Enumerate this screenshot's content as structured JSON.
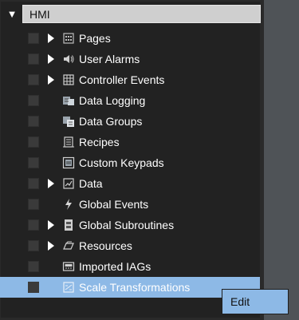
{
  "tree": {
    "root_label": "HMI",
    "items": [
      {
        "label": "Pages",
        "icon": "pages-icon",
        "expandable": true
      },
      {
        "label": "User Alarms",
        "icon": "speaker-icon",
        "expandable": true
      },
      {
        "label": "Controller Events",
        "icon": "grid-icon",
        "expandable": true
      },
      {
        "label": "Data Logging",
        "icon": "data-logging-icon",
        "expandable": false
      },
      {
        "label": "Data Groups",
        "icon": "data-groups-icon",
        "expandable": false
      },
      {
        "label": "Recipes",
        "icon": "recipes-icon",
        "expandable": false
      },
      {
        "label": "Custom Keypads",
        "icon": "keypad-icon",
        "expandable": false
      },
      {
        "label": "Data",
        "icon": "data-icon",
        "expandable": true
      },
      {
        "label": "Global Events",
        "icon": "lightning-icon",
        "expandable": false
      },
      {
        "label": "Global Subroutines",
        "icon": "subroutine-icon",
        "expandable": true
      },
      {
        "label": "Resources",
        "icon": "resources-icon",
        "expandable": true
      },
      {
        "label": "Imported IAGs",
        "icon": "iag-icon",
        "expandable": false
      },
      {
        "label": "Scale Transformations",
        "icon": "scale-icon",
        "expandable": false,
        "selected": true
      }
    ]
  },
  "context_menu": {
    "items": [
      "Edit"
    ]
  },
  "colors": {
    "panel_bg": "#222222",
    "selection": "#8db9e6",
    "root_header": "#cfcfcf",
    "right_pane": "#4f5357"
  }
}
